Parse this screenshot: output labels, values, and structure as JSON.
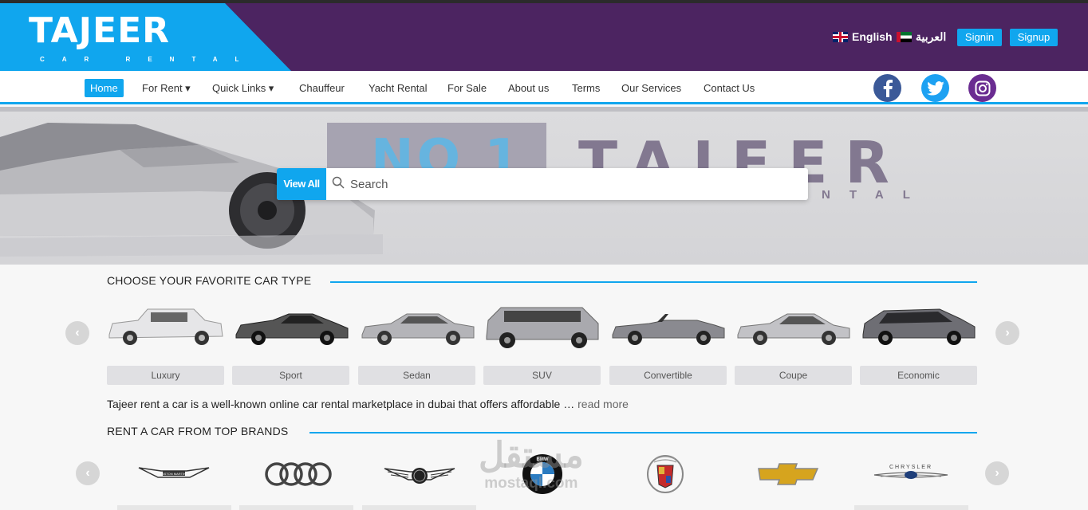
{
  "header": {
    "logo_title": "TAJEER",
    "logo_subtitle": "CAR RENTAL",
    "lang_english": "English",
    "lang_arabic": "العربية",
    "signin_label": "Signin",
    "signup_label": "Signup"
  },
  "nav": {
    "items": [
      "Home",
      "For Rent ▾",
      "Quick Links ▾",
      "Chauffeur",
      "Yacht Rental",
      "For Sale",
      "About us",
      "Terms",
      "Our Services",
      "Contact Us"
    ]
  },
  "hero": {
    "no1": "NO 1",
    "title": "TAJEER",
    "subtitle": "NTAL",
    "view_all_label": "View All",
    "search_placeholder": "Search"
  },
  "car_types": {
    "title": "CHOOSE YOUR FAVORITE CAR TYPE",
    "items": [
      "Luxury",
      "Sport",
      "Sedan",
      "SUV",
      "Convertible",
      "Coupe",
      "Economic"
    ]
  },
  "description": {
    "text": "Tajeer rent a car is a well-known online car rental marketplace in dubai that offers affordable …",
    "read_more": "read more"
  },
  "brands": {
    "title": "RENT A CAR FROM TOP BRANDS",
    "aston_label": "ASTON MARTIN",
    "bmw_label": "BMW",
    "chrysler_label": "CHRYSLER"
  },
  "watermark": {
    "arabic": "مستقل",
    "latin": "mostaql.com"
  },
  "colors": {
    "accent": "#10a6ee",
    "header_bg": "#4c2461",
    "facebook": "#3b5998",
    "twitter": "#1da1f2",
    "instagram": "#6a2c91"
  }
}
